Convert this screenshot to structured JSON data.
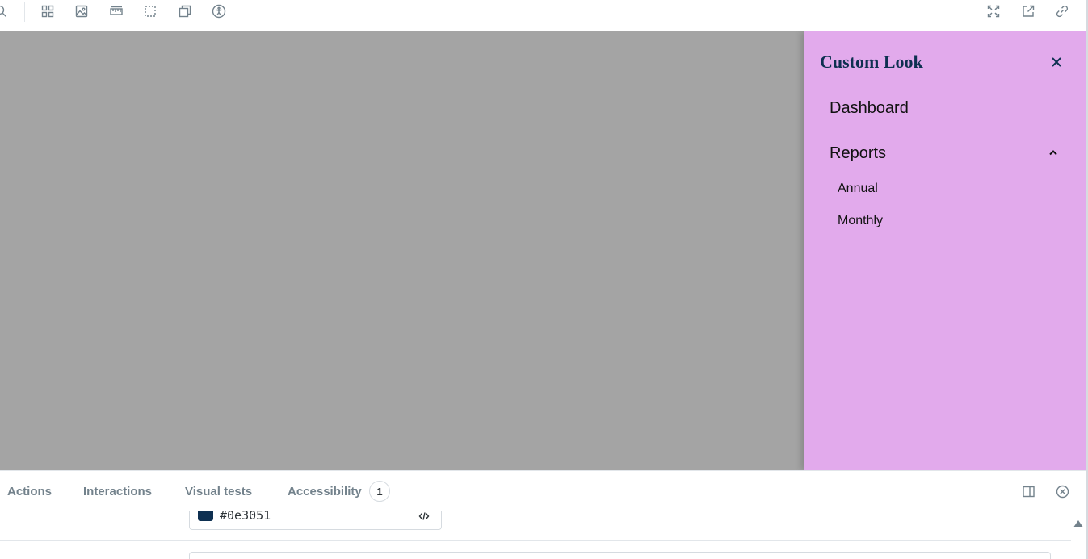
{
  "toolbar": {
    "left_icons": [
      "search-icon",
      "grid-icon",
      "image-icon",
      "ruler-icon",
      "outline-icon",
      "viewport-icon",
      "accessibility-icon"
    ],
    "right_icons": [
      "fullscreen-icon",
      "open-new-tab-icon",
      "link-icon"
    ]
  },
  "drawer": {
    "title": "Custom Look",
    "background": "#e2aaec",
    "title_color": "#0e3051",
    "items": [
      {
        "label": "Dashboard"
      },
      {
        "label": "Reports",
        "expanded": true,
        "children": [
          {
            "label": "Annual"
          },
          {
            "label": "Monthly"
          }
        ]
      }
    ]
  },
  "overlay_color": "#a4a4a4",
  "addons": {
    "tabs": [
      {
        "label": "Actions"
      },
      {
        "label": "Interactions"
      },
      {
        "label": "Visual tests"
      },
      {
        "label": "Accessibility",
        "badge": "1"
      }
    ],
    "color_value": "#0e3051",
    "swatch_color": "#0e3051"
  }
}
